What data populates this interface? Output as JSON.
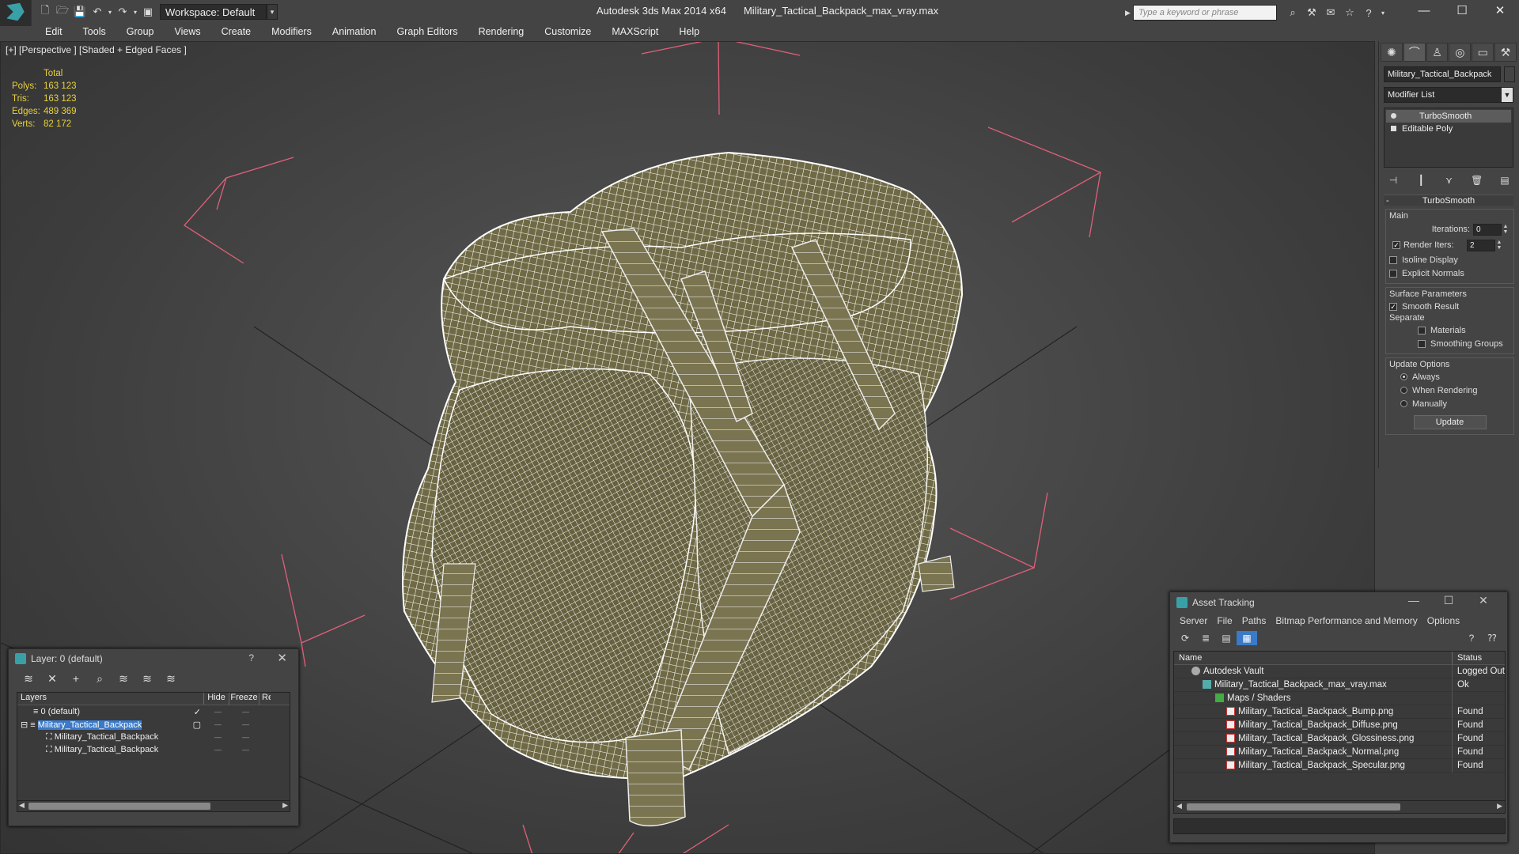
{
  "titlebar": {
    "workspace": "Workspace: Default",
    "app": "Autodesk 3ds Max  2014 x64",
    "file": "Military_Tactical_Backpack_max_vray.max",
    "search_placeholder": "Type a keyword or phrase"
  },
  "menu": [
    "Edit",
    "Tools",
    "Group",
    "Views",
    "Create",
    "Modifiers",
    "Animation",
    "Graph Editors",
    "Rendering",
    "Customize",
    "MAXScript",
    "Help"
  ],
  "viewport": {
    "label": "[+] [Perspective ] [Shaded + Edged Faces ]",
    "stats": {
      "header": "Total",
      "rows": [
        {
          "k": "Polys:",
          "v": "163 123"
        },
        {
          "k": "Tris:",
          "v": "163 123"
        },
        {
          "k": "Edges:",
          "v": "489 369"
        },
        {
          "k": "Verts:",
          "v": "82 172"
        }
      ]
    }
  },
  "command_panel": {
    "object_name": "Military_Tactical_Backpack",
    "modifier_list": "Modifier List",
    "stack": [
      "TurboSmooth",
      "Editable Poly"
    ],
    "rollout": "TurboSmooth",
    "main_label": "Main",
    "iterations_label": "Iterations:",
    "iterations": "0",
    "render_iters_label": "Render Iters:",
    "render_iters": "2",
    "isoline": "Isoline Display",
    "explicit_normals": "Explicit Normals",
    "surface_label": "Surface Parameters",
    "smooth_result": "Smooth Result",
    "separate": "Separate",
    "materials": "Materials",
    "smoothing_groups": "Smoothing Groups",
    "update_options": "Update Options",
    "always": "Always",
    "when_rendering": "When Rendering",
    "manually": "Manually",
    "update": "Update"
  },
  "layer_dialog": {
    "title": "Layer: 0 (default)",
    "help": "?",
    "cols": [
      "Layers",
      "Hide",
      "Freeze",
      "Re"
    ],
    "rows": [
      "0 (default)",
      "Military_Tactical_Backpack",
      "Military_Tactical_Backpack",
      "Military_Tactical_Backpack"
    ]
  },
  "asset_dialog": {
    "title": "Asset Tracking",
    "menu": [
      "Server",
      "File",
      "Paths",
      "Bitmap Performance and Memory",
      "Options"
    ],
    "cols": [
      "Name",
      "Status"
    ],
    "rows": [
      {
        "name": "Autodesk Vault",
        "status": "Logged Out"
      },
      {
        "name": "Military_Tactical_Backpack_max_vray.max",
        "status": "Ok"
      },
      {
        "name": "Maps / Shaders",
        "status": ""
      },
      {
        "name": "Military_Tactical_Backpack_Bump.png",
        "status": "Found"
      },
      {
        "name": "Military_Tactical_Backpack_Diffuse.png",
        "status": "Found"
      },
      {
        "name": "Military_Tactical_Backpack_Glossiness.png",
        "status": "Found"
      },
      {
        "name": "Military_Tactical_Backpack_Normal.png",
        "status": "Found"
      },
      {
        "name": "Military_Tactical_Backpack_Specular.png",
        "status": "Found"
      }
    ]
  },
  "colors": {
    "stat_yellow": "#e8d23a",
    "selection_blue": "#3a7ac8",
    "bbox_pink": "#e0607a",
    "mesh_olive": "#6f6a45",
    "wire_white": "#ffffff"
  }
}
